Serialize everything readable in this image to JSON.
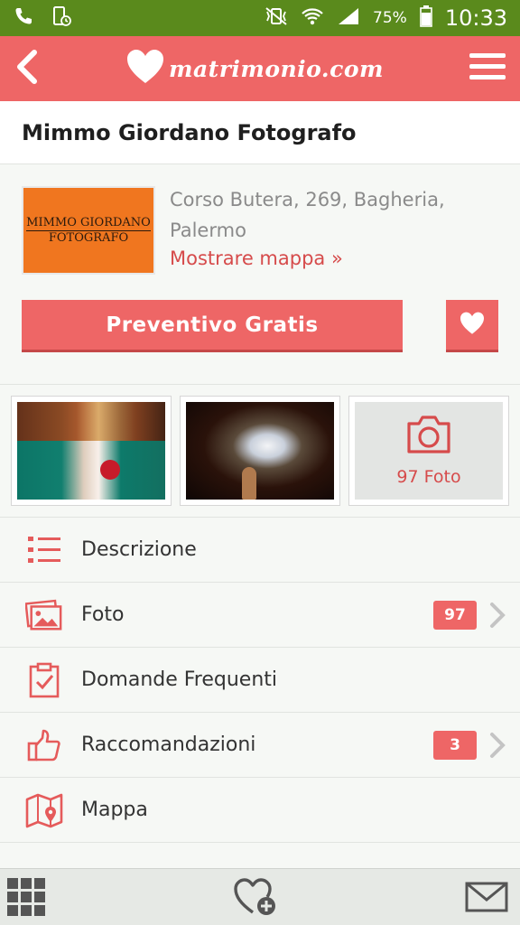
{
  "status_bar": {
    "battery_percent": "75%",
    "time": "10:33"
  },
  "header": {
    "brand": "matrimonio.com"
  },
  "vendor": {
    "name": "Mimmo Giordano Fotografo",
    "logo_line1": "MIMMO GIORDANO",
    "logo_line2": "FOTOGRAFO",
    "address": "Corso Butera, 269, Bagheria, Palermo",
    "map_link": "Mostrare mappa »",
    "quote_button": "Preventivo Gratis"
  },
  "photos": {
    "count_label": "97 Foto"
  },
  "menu": {
    "items": [
      {
        "label": "Descrizione",
        "icon": "list-icon"
      },
      {
        "label": "Foto",
        "icon": "photos-icon",
        "badge": "97"
      },
      {
        "label": "Domande Frequenti",
        "icon": "clipboard-check-icon"
      },
      {
        "label": "Raccomandazioni",
        "icon": "thumbs-up-icon",
        "badge": "3"
      },
      {
        "label": "Mappa",
        "icon": "map-pin-icon"
      }
    ]
  },
  "colors": {
    "brand": "#ee6666",
    "status_bar": "#5a8a1c",
    "link": "#d64b4b"
  }
}
